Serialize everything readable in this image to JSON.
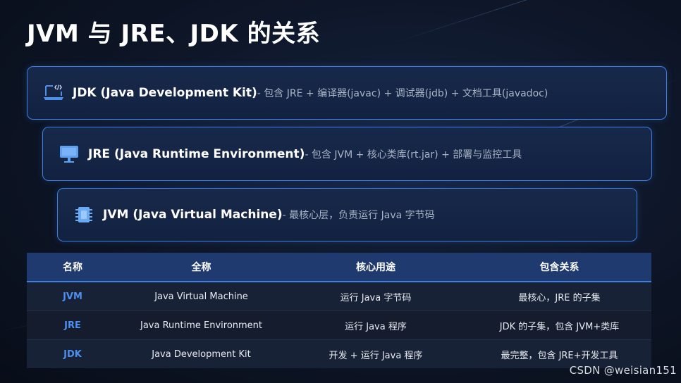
{
  "title": "JVM 与 JRE、JDK 的关系",
  "layers": [
    {
      "icon": "laptop-code-icon",
      "name": "JDK (Java Development Kit)",
      "desc": "- 包含 JRE + 编译器(javac) + 调试器(jdb) + 文档工具(javadoc)"
    },
    {
      "icon": "desktop-monitor-icon",
      "name": "JRE (Java Runtime Environment)",
      "desc": "- 包含 JVM + 核心类库(rt.jar) + 部署与监控工具"
    },
    {
      "icon": "microchip-icon",
      "name": "JVM (Java Virtual Machine)",
      "desc": "- 最核心层，负责运行 Java 字节码"
    }
  ],
  "table": {
    "headers": [
      "名称",
      "全称",
      "核心用途",
      "包含关系"
    ],
    "rows": [
      [
        "JVM",
        "Java Virtual Machine",
        "运行 Java 字节码",
        "最核心，JRE 的子集"
      ],
      [
        "JRE",
        "Java Runtime Environment",
        "运行 Java 程序",
        "JDK 的子集，包含 JVM+类库"
      ],
      [
        "JDK",
        "Java Development Kit",
        "开发 + 运行 Java 程序",
        "最完整，包含 JRE+开发工具"
      ]
    ]
  },
  "watermark": "CSDN @weisian151",
  "colors": {
    "accent": "#3f7fe0",
    "key_text": "#4d8ef0",
    "header_bg": "#1e3a6e"
  }
}
